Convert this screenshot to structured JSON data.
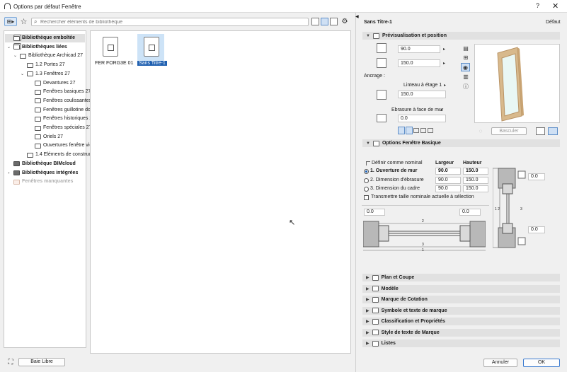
{
  "window": {
    "title": "Options par défaut Fenêtre",
    "help": "?",
    "close": "✕"
  },
  "search": {
    "placeholder": "Rechercher éléments de bibliothèque"
  },
  "tree": [
    {
      "label": "Bibliothèque emboîtée",
      "bold": true,
      "kind": "stack",
      "depth": 0,
      "tw": "",
      "selected": true
    },
    {
      "label": "Bibliothèques liées",
      "bold": true,
      "kind": "stack",
      "depth": 0,
      "tw": "v"
    },
    {
      "label": "Bibliothèque Archicad 27",
      "kind": "folder",
      "depth": 1,
      "tw": "v"
    },
    {
      "label": "1.2 Portes 27",
      "kind": "folder",
      "depth": 2,
      "tw": ""
    },
    {
      "label": "1.3 Fenêtres 27",
      "kind": "folder",
      "depth": 2,
      "tw": "v"
    },
    {
      "label": "Devantures 27",
      "kind": "folder",
      "depth": 3,
      "tw": ""
    },
    {
      "label": "Fenêtres basiques 27",
      "kind": "folder",
      "depth": 3,
      "tw": ""
    },
    {
      "label": "Fenêtres coulissantes 27",
      "kind": "folder",
      "depth": 3,
      "tw": ""
    },
    {
      "label": "Fenêtres guillotine doul",
      "kind": "folder",
      "depth": 3,
      "tw": ""
    },
    {
      "label": "Fenêtres historiques 27",
      "kind": "folder",
      "depth": 3,
      "tw": ""
    },
    {
      "label": "Fenêtres spéciales 27",
      "kind": "folder",
      "depth": 3,
      "tw": ""
    },
    {
      "label": "Oriels 27",
      "kind": "folder",
      "depth": 3,
      "tw": ""
    },
    {
      "label": "Ouvertures fenêtre vides",
      "kind": "folder",
      "depth": 3,
      "tw": ""
    },
    {
      "label": "1.4 Eléments de constructi",
      "kind": "folder",
      "depth": 2,
      "tw": ""
    },
    {
      "label": "Bibliothèque BIMcloud",
      "bold": true,
      "kind": "dark",
      "depth": 0,
      "tw": ""
    },
    {
      "label": "Bibliothèques intégrées",
      "bold": true,
      "kind": "dark",
      "depth": 0,
      "tw": ">"
    },
    {
      "label": "Fenêtres manquantes",
      "bold": true,
      "kind": "faint",
      "depth": 0,
      "tw": "",
      "faint": true
    }
  ],
  "files": [
    {
      "label": "FER FORG3E 01",
      "selected": false
    },
    {
      "label": "Sans Titre-1",
      "selected": true
    }
  ],
  "bottom_left": {
    "button": "Baie Libre"
  },
  "right": {
    "title": "Sans Titre-1",
    "default_label": "Défaut",
    "sections": {
      "preview": "Prévisualisation et position",
      "basic": "Options Fenêtre Basique",
      "plan": "Plan et Coupe",
      "model": "Modèle",
      "dim_marker": "Marque de Cotation",
      "symbol": "Symbole et texte de marque",
      "classif": "Classification et Propriétés",
      "marker_style": "Style de texte de Marque",
      "lists": "Listes"
    },
    "width_value": "90.0",
    "height_value": "150.0",
    "anchor_label": "Ancrage :",
    "anchor_option": "Linteau à étage 1",
    "anchor_value": "150.0",
    "reveal_option": "Ebrasure à face de mur",
    "reveal_value": "0.0",
    "flip_button": "Basculer",
    "basic": {
      "define_nominal": "Définir comme nominal",
      "col_width": "Largeur",
      "col_height": "Hauteur",
      "rows": [
        {
          "label": "1. Ouverture de mur",
          "w": "90.0",
          "h": "150.0",
          "selected": true
        },
        {
          "label": "2. Dimension d'ébrasure",
          "w": "90.0",
          "h": "150.0",
          "selected": false
        },
        {
          "label": "3. Dimension du cadre",
          "w": "90.0",
          "h": "150.0",
          "selected": false
        }
      ],
      "transmit": "Transmettre taille nominale actuelle à sélection",
      "left_val": "0.0",
      "right_val": "0.0",
      "top_val": "0.0",
      "bottom_val": "0.0"
    },
    "cancel": "Annuler",
    "ok": "OK"
  }
}
